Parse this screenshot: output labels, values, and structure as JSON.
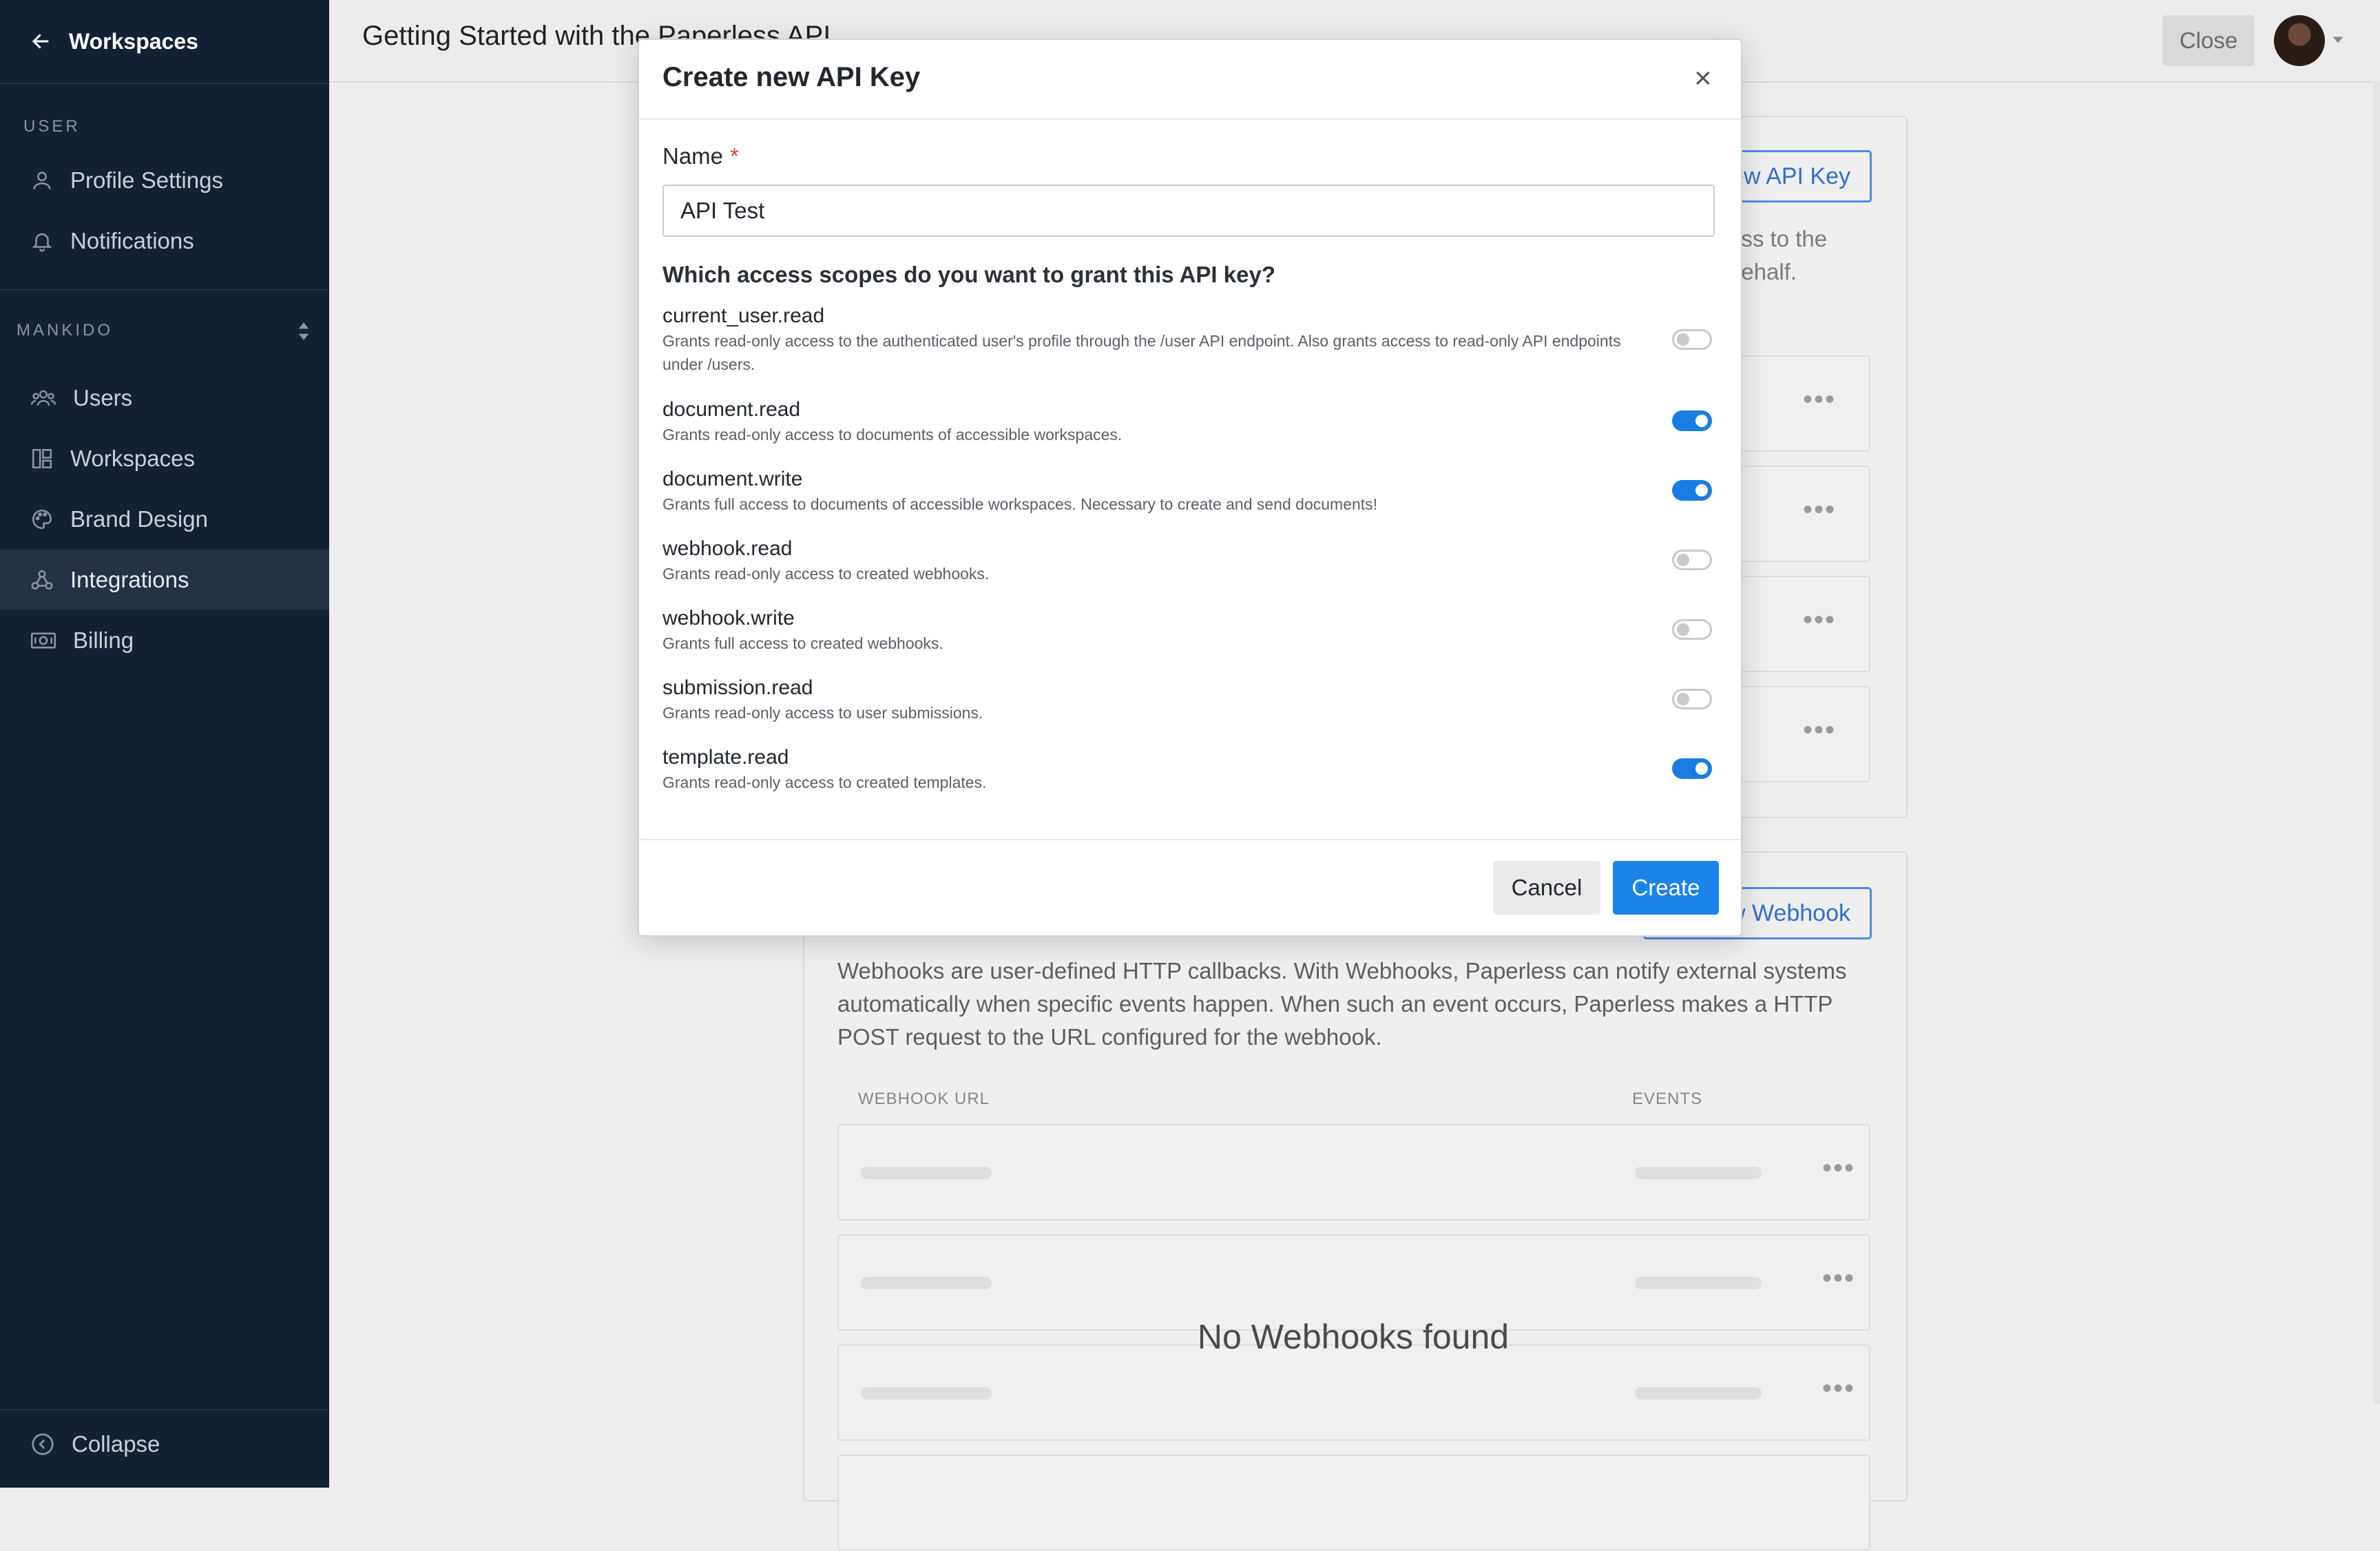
{
  "sidebar": {
    "back_label": "Workspaces",
    "section_user": "USER",
    "profile_settings": "Profile Settings",
    "notifications": "Notifications",
    "section_org": "MANKIDO",
    "users": "Users",
    "workspaces": "Workspaces",
    "brand_design": "Brand Design",
    "integrations": "Integrations",
    "billing": "Billing",
    "collapse": "Collapse",
    "active_item": "Integrations"
  },
  "header": {
    "title": "Getting Started with the Paperless API",
    "close_label": "Close"
  },
  "background": {
    "api_key_button": "New API Key",
    "api_desc_line1": "ess to the",
    "api_desc_line2": "behalf.",
    "webhook_button": "New Webhook",
    "webhook_description": "Webhooks are user-defined HTTP callbacks. With Webhooks, Paperless can notify external systems automatically when specific events happen. When such an event occurs, Paperless makes a HTTP POST request to the URL configured for the webhook.",
    "col_webhook_url": "WEBHOOK URL",
    "col_events": "EVENTS",
    "empty_message": "No Webhooks found"
  },
  "modal": {
    "title": "Create new API Key",
    "name_label": "Name",
    "name_value": "API Test",
    "scopes_question": "Which access scopes do you want to grant this API key?",
    "scopes": [
      {
        "name": "current_user.read",
        "description": "Grants read-only access to the authenticated user's profile through the /user API endpoint. Also grants access to read-only API endpoints under /users.",
        "enabled": false
      },
      {
        "name": "document.read",
        "description": "Grants read-only access to documents of accessible workspaces.",
        "enabled": true
      },
      {
        "name": "document.write",
        "description": "Grants full access to documents of accessible workspaces. Necessary to create and send documents!",
        "enabled": true
      },
      {
        "name": "webhook.read",
        "description": "Grants read-only access to created webhooks.",
        "enabled": false
      },
      {
        "name": "webhook.write",
        "description": "Grants full access to created webhooks.",
        "enabled": false
      },
      {
        "name": "submission.read",
        "description": "Grants read-only access to user submissions.",
        "enabled": false
      },
      {
        "name": "template.read",
        "description": "Grants read-only access to created templates.",
        "enabled": true
      }
    ],
    "cancel_label": "Cancel",
    "create_label": "Create"
  },
  "colors": {
    "sidebar_bg": "#142134",
    "accent": "#1c83e8",
    "toggle_on": "#1a7de3"
  }
}
